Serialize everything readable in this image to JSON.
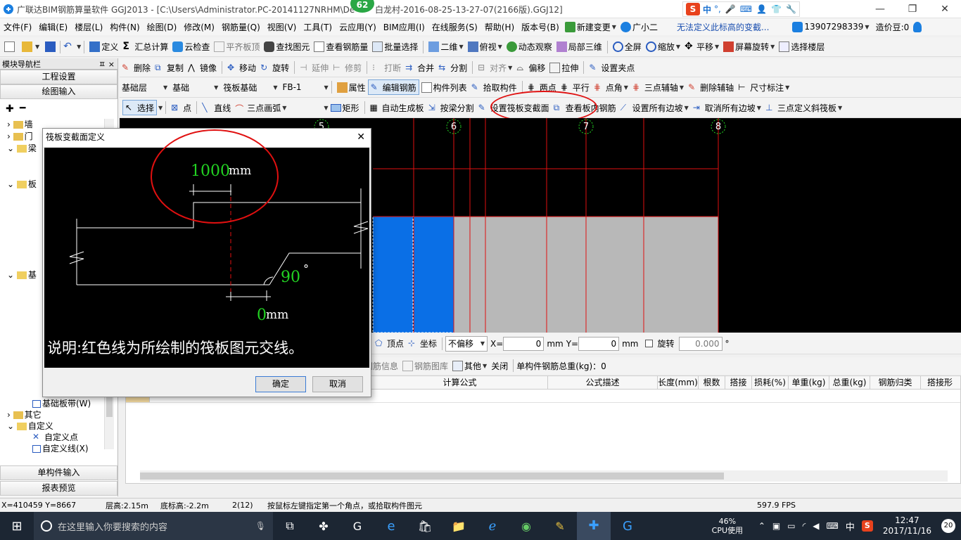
{
  "app": {
    "title": "广联达BIM钢筋算量软件 GGJ2013 - [C:\\Users\\Administrator.PC-20141127NRHM\\De",
    "title_tail": "白龙村-2016-08-25-13-27-07(2166版).GGJ12]",
    "badge": "62"
  },
  "ime": {
    "label": "中",
    "punct": "°,"
  },
  "menu": [
    "文件(F)",
    "编辑(E)",
    "楼层(L)",
    "构件(N)",
    "绘图(D)",
    "修改(M)",
    "钢筋量(Q)",
    "视图(V)",
    "工具(T)",
    "云应用(Y)",
    "BIM应用(I)",
    "在线服务(S)",
    "帮助(H)",
    "版本号(B)"
  ],
  "menu_extra": {
    "new_change": "新建变更",
    "assistant": "广小二",
    "notice": "无法定义此标高的变截...",
    "phone": "13907298339",
    "price": "造价豆:0"
  },
  "toolbar1": [
    "定义",
    "汇总计算",
    "云检查",
    "平齐板顶",
    "查找图元",
    "查看钢筋量",
    "批量选择",
    "二维",
    "俯视",
    "动态观察",
    "局部三维",
    "全屏",
    "缩放",
    "平移",
    "屏幕旋转",
    "选择楼层"
  ],
  "toolbar2": [
    "删除",
    "复制",
    "镜像",
    "移动",
    "旋转",
    "延伸",
    "修剪",
    "打断",
    "合并",
    "分割",
    "对齐",
    "偏移",
    "拉伸",
    "设置夹点"
  ],
  "toolbar3": {
    "floor": "基础层",
    "layer": "基础",
    "type": "筏板基础",
    "item": "FB-1",
    "buttons": [
      "属性",
      "编辑钢筋",
      "构件列表",
      "拾取构件",
      "两点",
      "平行",
      "点角",
      "三点辅轴",
      "删除辅轴",
      "尺寸标注"
    ]
  },
  "toolbar4": [
    "选择",
    "点",
    "直线",
    "三点画弧",
    "矩形",
    "自动生成板",
    "按梁分割",
    "设置筏板变截面",
    "查看板内钢筋",
    "设置所有边坡",
    "取消所有边坡",
    "三点定义斜筏板"
  ],
  "nav": {
    "title": "模块导航栏",
    "pin": "ㅍ ×",
    "btn_project": "工程设置",
    "btn_draw": "绘图输入",
    "tree": [
      "墙",
      "门",
      "梁",
      "板",
      "基",
      "基础板带(W)",
      "其它",
      "自定义",
      "自定义点",
      "自定义线(X)"
    ],
    "btn_single": "单构件输入",
    "btn_report": "报表预览"
  },
  "axes": [
    "5",
    "6",
    "7",
    "8"
  ],
  "dialog": {
    "title": "筏板变截面定义",
    "top_value": "1000",
    "top_unit": "mm",
    "bottom_value": "0",
    "bottom_unit": "mm",
    "angle_value": "90",
    "angle_unit": "°",
    "note": "说明:红色线为所绘制的筏板图元交线。",
    "ok": "确定",
    "cancel": "取消"
  },
  "coord": {
    "vertex": "顶点",
    "coord": "坐标",
    "offset": "不偏移",
    "x_label": "X=",
    "x_value": "0",
    "y_label": "Y=",
    "y_value": "0",
    "unit": "mm",
    "rotate": "旋转",
    "rotate_value": "0.000",
    "deg": "°"
  },
  "rebar_toolbar": {
    "info": "钢筋信息",
    "lib": "钢筋图库",
    "other": "其他",
    "close": "关闭",
    "total": "单构件钢筋总重(kg)：0"
  },
  "grid_headers": [
    "计算公式",
    "公式描述",
    "长度(mm)",
    "根数",
    "搭接",
    "损耗(%)",
    "单重(kg)",
    "总重(kg)",
    "钢筋归类",
    "搭接形"
  ],
  "status": {
    "coords": "X=410459 Y=8667",
    "floor_height": "层高:2.15m",
    "bottom_height": "底标高:-2.2m",
    "count": "2(12)",
    "hint": "按鼠标左键指定第一个角点，或拾取构件图元",
    "fps": "597.9 FPS"
  },
  "taskbar": {
    "search": "在这里输入你要搜索的内容",
    "cpu": "46%",
    "cpu_label": "CPU使用",
    "lang": "中",
    "time": "12:47",
    "date": "2017/11/16",
    "notif": "20"
  },
  "colors": {
    "accent_blue": "#0a6fe6",
    "red": "#e01010",
    "green": "#22d322",
    "canvas": "#000000",
    "slab_grey": "#b8b8b8"
  }
}
